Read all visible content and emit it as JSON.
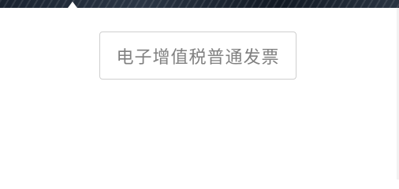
{
  "invoice_options": {
    "selected_label": "电子增值税普通发票"
  }
}
